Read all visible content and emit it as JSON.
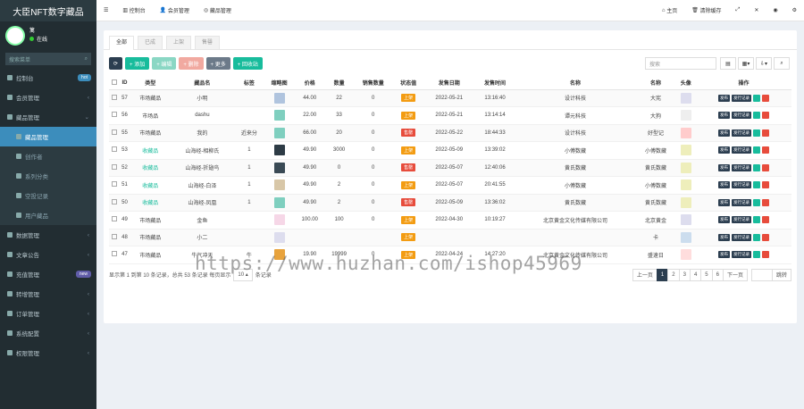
{
  "app": {
    "title": "大臣NFT数字藏品"
  },
  "user": {
    "name": "篱",
    "status": "在线"
  },
  "sidebar": {
    "search_placeholder": "搜索菜单",
    "items": [
      {
        "label": "控制台",
        "badge": "hot",
        "badge_color": "#3c8dbc"
      },
      {
        "label": "会员管理"
      },
      {
        "label": "藏品管理",
        "expanded": true
      }
    ],
    "sub_items": [
      {
        "label": "藏品管理",
        "active": true
      },
      {
        "label": "创作者"
      },
      {
        "label": "系列分类"
      },
      {
        "label": "空投记录"
      },
      {
        "label": "用户藏品"
      }
    ],
    "items2": [
      {
        "label": "数据管理"
      },
      {
        "label": "文章公告"
      },
      {
        "label": "充值管理",
        "badge": "new",
        "badge_color": "#605ca8"
      },
      {
        "label": "转增管理"
      },
      {
        "label": "订单管理"
      },
      {
        "label": "系统配置"
      },
      {
        "label": "权限管理"
      }
    ]
  },
  "header": {
    "left": [
      "控制台",
      "会员管理",
      "藏品管理"
    ],
    "right": [
      "主页",
      "清除缓存"
    ]
  },
  "tabs": [
    "全部",
    "已成",
    "上架",
    "售罄"
  ],
  "toolbar": {
    "buttons": [
      {
        "label": "",
        "icon": "refresh-icon",
        "color": "#2c3e50"
      },
      {
        "label": "添加",
        "color": "#18bc9c"
      },
      {
        "label": "编辑",
        "color": "#8ad7c4"
      },
      {
        "label": "删除",
        "color": "#f1a9a0"
      },
      {
        "label": "更多",
        "color": "#6c7a89"
      },
      {
        "label": "回收站",
        "color": "#18bc9c"
      }
    ],
    "search_placeholder": "搜索"
  },
  "table": {
    "headers": [
      "",
      "ID",
      "类型",
      "藏品名",
      "标签",
      "缩略图",
      "价格",
      "数量",
      "销售数量",
      "状态值",
      "发售日期",
      "发售时间",
      "名称",
      "名称",
      "头像",
      "操作"
    ],
    "rows": [
      {
        "id": "57",
        "type": "市场藏品",
        "name": "小明",
        "tag": "",
        "price": "44.00",
        "qty": "22",
        "sold": "0",
        "status": "上架",
        "status_color": "#f39c12",
        "date": "2022-05-21",
        "time": "13:16:40",
        "c1": "设计科技",
        "c2": "大宪",
        "thumb": "#b0c4de",
        "avatar": "#dde"
      },
      {
        "id": "56",
        "type": "市场品",
        "name": "dashu",
        "tag": "",
        "price": "22.00",
        "qty": "33",
        "sold": "0",
        "status": "上架",
        "status_color": "#f39c12",
        "date": "2022-05-21",
        "time": "13:14:14",
        "c1": "谭元科技",
        "c2": "大狗",
        "thumb": "#7fcfbf",
        "avatar": "#eee"
      },
      {
        "id": "55",
        "type": "市场藏品",
        "name": "我的",
        "tag": "近来分",
        "price": "66.00",
        "qty": "20",
        "sold": "0",
        "status": "售罄",
        "status_color": "#e74c3c",
        "date": "2022-05-22",
        "time": "18:44:33",
        "c1": "设计科技",
        "c2": "好型记",
        "thumb": "#7fcfbf",
        "avatar": "#fcc"
      },
      {
        "id": "53",
        "type": "收藏品",
        "name": "山海经-相柳氏",
        "tag": "1",
        "price": "49.90",
        "qty": "3000",
        "sold": "0",
        "status": "上架",
        "status_color": "#f39c12",
        "date": "2022-05-09",
        "time": "13:39:02",
        "c1": "小傅数藏",
        "c2": "小傅数藏",
        "thumb": "#2d3b45",
        "avatar": "#eeb"
      },
      {
        "id": "52",
        "type": "收藏品",
        "name": "山海经-折翅鸟",
        "tag": "1",
        "price": "49.90",
        "qty": "0",
        "sold": "0",
        "status": "售罄",
        "status_color": "#e74c3c",
        "date": "2022-05-07",
        "time": "12:40:06",
        "c1": "黄氏数藏",
        "c2": "黄氏数藏",
        "thumb": "#3a4a55",
        "avatar": "#eeb"
      },
      {
        "id": "51",
        "type": "收藏品",
        "name": "山海经-白泽",
        "tag": "1",
        "price": "49.90",
        "qty": "2",
        "sold": "0",
        "status": "上架",
        "status_color": "#f39c12",
        "date": "2022-05-07",
        "time": "20:41:55",
        "c1": "小傅数藏",
        "c2": "小傅数藏",
        "thumb": "#d8c7a8",
        "avatar": "#eeb"
      },
      {
        "id": "50",
        "type": "收藏品",
        "name": "山海经-凤凰",
        "tag": "1",
        "price": "49.90",
        "qty": "2",
        "sold": "0",
        "status": "售罄",
        "status_color": "#e74c3c",
        "date": "2022-05-09",
        "time": "13:36:02",
        "c1": "黄氏数藏",
        "c2": "黄氏数藏",
        "thumb": "#7fcfbf",
        "avatar": "#eeb"
      },
      {
        "id": "49",
        "type": "市场藏品",
        "name": "金鱼",
        "tag": "",
        "price": "100.00",
        "qty": "100",
        "sold": "0",
        "status": "上架",
        "status_color": "#f39c12",
        "date": "2022-04-30",
        "time": "10:19:27",
        "c1": "北京黄金文化传媒有限公司",
        "c2": "北京黄金",
        "thumb": "#f6d7e7",
        "avatar": "#dde"
      },
      {
        "id": "48",
        "type": "市场藏品",
        "name": "小二",
        "tag": "",
        "price": "",
        "qty": "",
        "sold": "",
        "status": "上架",
        "status_color": "#f39c12",
        "date": "",
        "time": "",
        "c1": "",
        "c2": "卡",
        "thumb": "#dde",
        "avatar": "#cde"
      },
      {
        "id": "47",
        "type": "市场藏品",
        "name": "牛气冲天",
        "tag": "牛",
        "price": "19.90",
        "qty": "19999",
        "sold": "0",
        "status": "上架",
        "status_color": "#f39c12",
        "date": "2022-04-24",
        "time": "14:27:20",
        "c1": "北京黄金文化传媒有限公司",
        "c2": "盛速日",
        "thumb": "#e8a33d",
        "avatar": "#fdd"
      }
    ]
  },
  "row_actions": {
    "a": "发布",
    "b": "发行记录"
  },
  "footer": {
    "text": "显示第 1 到第 10 条记录，总共 53 条记录 每页显示",
    "page_size": "10",
    "suffix": "条记录",
    "pages": [
      "上一页",
      "1",
      "2",
      "3",
      "4",
      "5",
      "6",
      "下一页"
    ],
    "goto": "跳转"
  },
  "watermark": "https://www.huzhan.com/ishop45969"
}
